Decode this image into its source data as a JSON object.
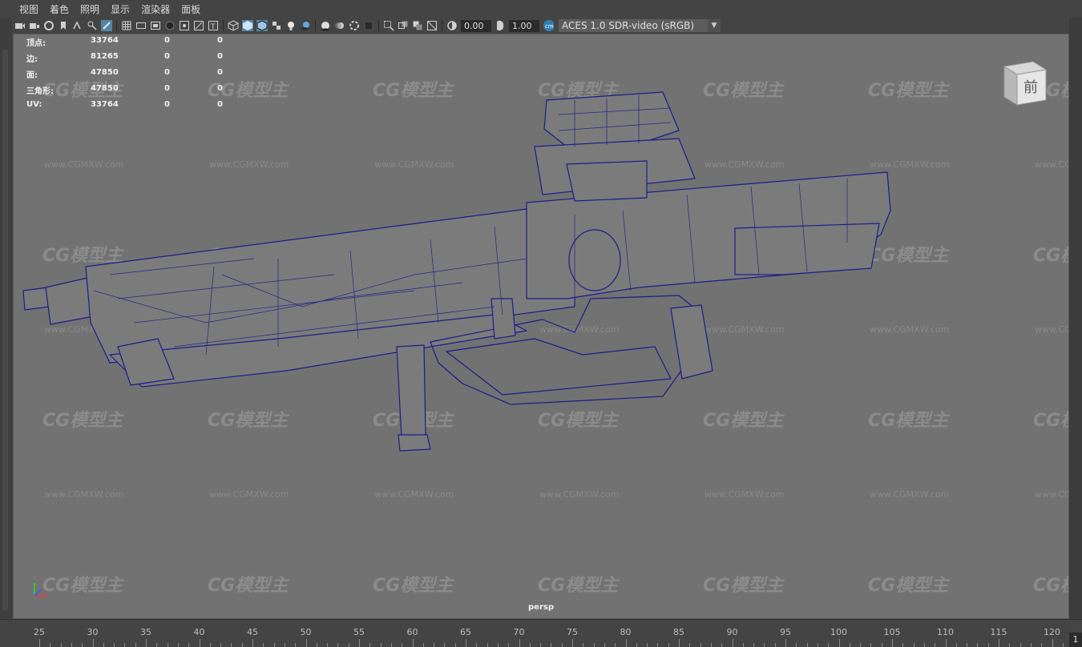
{
  "menubar": {
    "items": [
      "视图",
      "着色",
      "照明",
      "显示",
      "渲染器",
      "面板"
    ]
  },
  "toolbar": {
    "exposure_value": "0.00",
    "gamma_value": "1.00",
    "color_space": "ACES 1.0 SDR-video (sRGB)"
  },
  "hud": {
    "rows": [
      {
        "label": "顶点:",
        "total": "33764",
        "selected": "0",
        "ignored": "0"
      },
      {
        "label": "边:",
        "total": "81265",
        "selected": "0",
        "ignored": "0"
      },
      {
        "label": "面:",
        "total": "47850",
        "selected": "0",
        "ignored": "0"
      },
      {
        "label": "三角形:",
        "total": "47850",
        "selected": "0",
        "ignored": "0"
      },
      {
        "label": "UV:",
        "total": "33764",
        "selected": "0",
        "ignored": "0"
      }
    ]
  },
  "viewport": {
    "camera_label": "persp",
    "viewcube_face": "前",
    "background_color": "#727272",
    "wireframe_color": "#1c1c8c",
    "watermark_text": "CG模型主",
    "watermark_url": "www.CGMXW.com"
  },
  "timeline": {
    "ticks": [
      "25",
      "30",
      "35",
      "40",
      "45",
      "50",
      "55",
      "60",
      "65",
      "70",
      "75",
      "80",
      "85",
      "90",
      "95",
      "100",
      "105",
      "110",
      "115",
      "120"
    ],
    "current_frame": "1"
  }
}
